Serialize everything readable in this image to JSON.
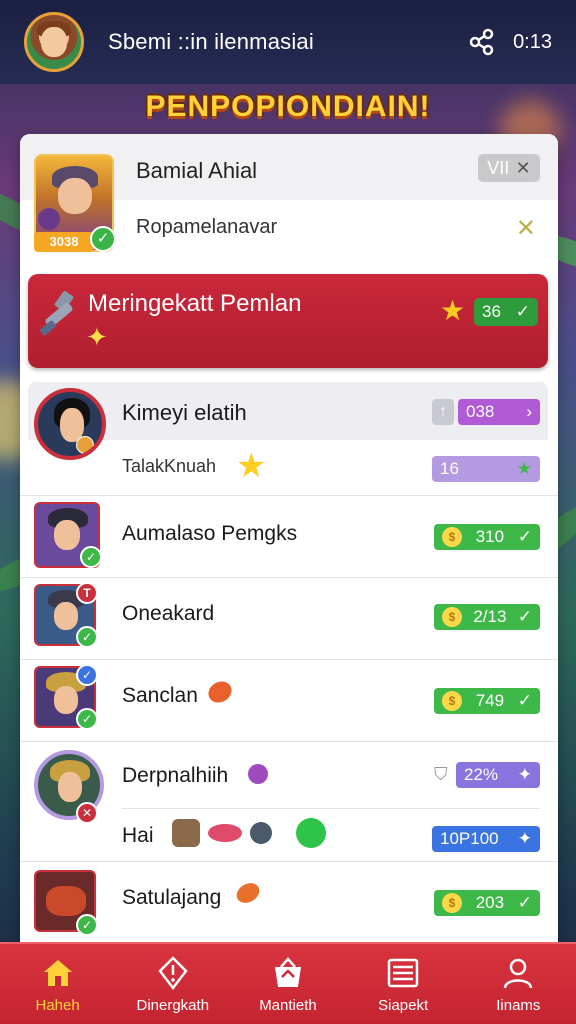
{
  "header": {
    "title": "Sbemi ::in ilenmasiai",
    "time": "0:13"
  },
  "banner": {
    "text": "PENPOPIONDIAIN!"
  },
  "profile": {
    "name": "Bamial Ahial",
    "subtitle": "Ropamelanavar",
    "coins": "3038",
    "level": "VII"
  },
  "promo": {
    "title": "Meringekatt Pemlan",
    "badge_value": "36"
  },
  "rows": [
    {
      "name": "Kimeyi elatih",
      "sub": "TalakKnuah",
      "value": "038",
      "sub_value": "16",
      "color": "#b05ad6",
      "sub_color": "#b49ae0"
    },
    {
      "name": "Aumalaso Pemgks",
      "value": "310",
      "color": "#3fb84a"
    },
    {
      "name": "Oneakard",
      "value": "2/13",
      "color": "#3fb84a"
    },
    {
      "name": "Sanclan",
      "value": "749",
      "color": "#3fb84a"
    },
    {
      "name": "Derpnalhiih",
      "sub": "Hai",
      "value": "22%",
      "sub_value": "10P100",
      "color": "#8a74e0",
      "sub_color": "#3a74e0"
    },
    {
      "name": "Satulajang",
      "value": "203",
      "color": "#3fb84a"
    }
  ],
  "nav": [
    {
      "label": "Haheh",
      "icon": "home-icon",
      "active": true
    },
    {
      "label": "Dinergkath",
      "icon": "shield-icon",
      "active": false
    },
    {
      "label": "Mantieth",
      "icon": "gift-icon",
      "active": false
    },
    {
      "label": "Siapekt",
      "icon": "list-icon",
      "active": false
    },
    {
      "label": "Iinams",
      "icon": "user-icon",
      "active": false
    }
  ],
  "colors": {
    "accent_red": "#c9283a",
    "green": "#3fb84a",
    "gold": "#ffd23a"
  }
}
